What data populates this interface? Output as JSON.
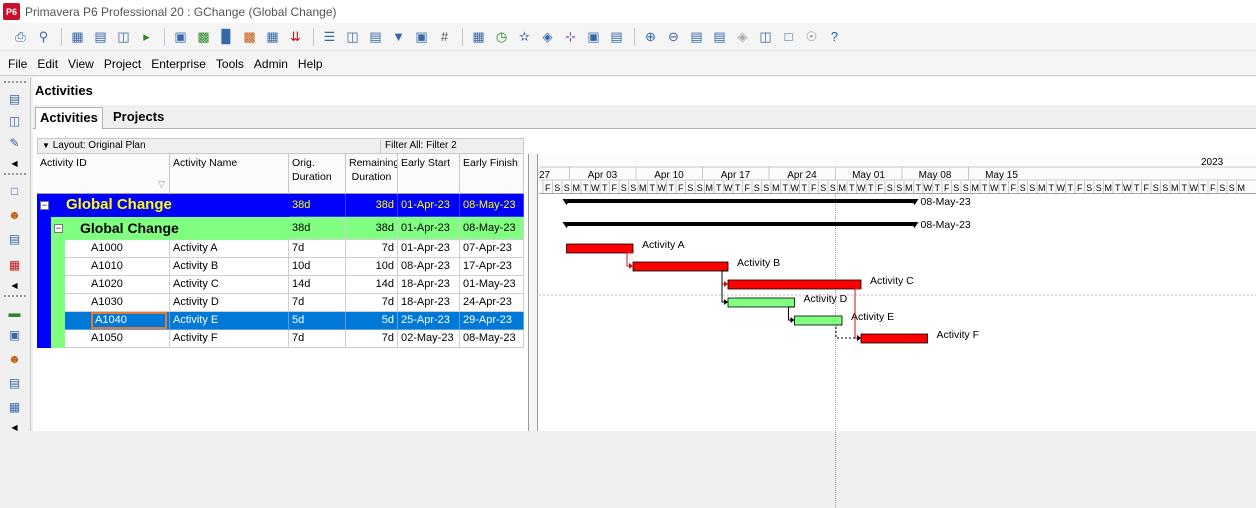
{
  "window": {
    "title": "Primavera P6 Professional 20 : GChange (Global Change)",
    "logo": "P6"
  },
  "toolbar": {
    "icons": [
      "print-icon",
      "print-preview-icon",
      "table-icon",
      "gantt-icon",
      "network-icon",
      "trace-logic-icon",
      "filter-icon",
      "group-icon",
      "layout-icon",
      "bars-icon",
      "columns-icon",
      "timescale-icon",
      "filter-funnel-icon",
      "hash-icon",
      "calendar-icon",
      "schedule-icon",
      "level-icon",
      "link-icon",
      "split-icon",
      "store-icon",
      "zoom-in-icon",
      "zoom-out-icon",
      "help-icon"
    ]
  },
  "menu": {
    "items": [
      "File",
      "Edit",
      "View",
      "Project",
      "Enterprise",
      "Tools",
      "Admin",
      "Help"
    ]
  },
  "panel": {
    "title": "Activities"
  },
  "tabs": [
    {
      "label": "Activities"
    },
    {
      "label": "Projects"
    }
  ],
  "grid": {
    "layout_label": "Layout: Original Plan",
    "filter_label": "Filter All: Filter 2",
    "headers": {
      "activity_id": "Activity ID",
      "activity_name": "Activity Name",
      "orig_duration": "Orig. Duration",
      "remaining_duration": "Remaining Duration",
      "early_start": "Early Start",
      "early_finish": "Early Finish"
    },
    "groups": [
      {
        "label": "Global Change",
        "orig": "38d",
        "rem": "38d",
        "start": "01-Apr-23",
        "finish": "08-May-23",
        "color": "#0000ff",
        "text_color": "#ffff00"
      },
      {
        "label": "Global Change",
        "orig": "38d",
        "rem": "38d",
        "start": "01-Apr-23",
        "finish": "08-May-23",
        "color": "#7fff7f",
        "text_color": "#000000"
      }
    ],
    "rows": [
      {
        "id": "A1000",
        "name": "Activity A",
        "orig": "7d",
        "rem": "7d",
        "start": "01-Apr-23",
        "finish": "07-Apr-23",
        "selected": false,
        "critical": true
      },
      {
        "id": "A1010",
        "name": "Activity B",
        "orig": "10d",
        "rem": "10d",
        "start": "08-Apr-23",
        "finish": "17-Apr-23",
        "selected": false,
        "critical": true
      },
      {
        "id": "A1020",
        "name": "Activity C",
        "orig": "14d",
        "rem": "14d",
        "start": "18-Apr-23",
        "finish": "01-May-23",
        "selected": false,
        "critical": true
      },
      {
        "id": "A1030",
        "name": "Activity D",
        "orig": "7d",
        "rem": "7d",
        "start": "18-Apr-23",
        "finish": "24-Apr-23",
        "selected": false,
        "critical": false
      },
      {
        "id": "A1040",
        "name": "Activity E",
        "orig": "5d",
        "rem": "5d",
        "start": "25-Apr-23",
        "finish": "29-Apr-23",
        "selected": true,
        "critical": false
      },
      {
        "id": "A1050",
        "name": "Activity F",
        "orig": "7d",
        "rem": "7d",
        "start": "02-May-23",
        "finish": "08-May-23",
        "selected": false,
        "critical": true
      }
    ]
  },
  "gantt": {
    "year_label": "2023",
    "first_week_label": "27",
    "weeks": [
      "Apr 03",
      "Apr 10",
      "Apr 17",
      "Apr 24",
      "May 01",
      "May 08",
      "May 15"
    ],
    "day_letters": [
      "F",
      "S",
      "S",
      "M",
      "T",
      "W",
      "T",
      "F",
      "S",
      "S",
      "M",
      "T",
      "W",
      "T",
      "F",
      "S",
      "S",
      "M",
      "T",
      "W",
      "T",
      "F",
      "S",
      "S",
      "M",
      "T",
      "W",
      "T",
      "F",
      "S",
      "S",
      "M",
      "T",
      "W",
      "T",
      "F",
      "S",
      "S",
      "M",
      "T",
      "W",
      "T",
      "F",
      "S",
      "S",
      "M",
      "T",
      "W",
      "T",
      "F",
      "S",
      "S",
      "M",
      "T",
      "W",
      "T",
      "F",
      "S",
      "S",
      "M",
      "T",
      "W",
      "T",
      "F",
      "S",
      "S",
      "M",
      "T",
      "W",
      "T",
      "F",
      "S",
      "S",
      "M"
    ],
    "summary_labels": [
      "08-May-23",
      "08-May-23"
    ],
    "colors": {
      "critical": "#ff0000",
      "noncritical": "#80ff80",
      "summary": "#000000",
      "group1": "#0000ff",
      "group2": "#80ff80",
      "selected": "#0078d7"
    }
  }
}
